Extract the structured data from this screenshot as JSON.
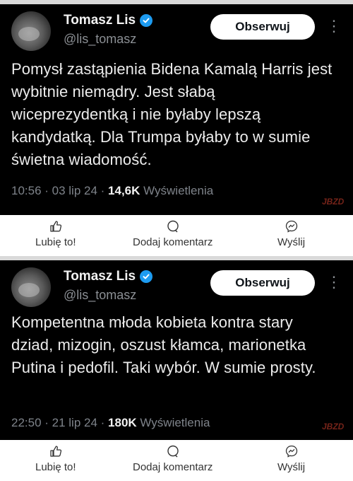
{
  "posts": [
    {
      "author_name": "Tomasz Lis",
      "handle": "@lis_tomasz",
      "follow_label": "Obserwuj",
      "text": "Pomysł zastąpienia Bidena Kamalą Harris jest wybitnie niemądry. Jest słabą wiceprezydentką i nie byłaby lepszą kandydatką. Dla Trumpa  byłaby to w sumie świetna wiadomość.",
      "time_date": "10:56 · 03 lip 24 · ",
      "views_count": "14,6K",
      "views_label": " Wyświetlenia",
      "watermark": "JBZD"
    },
    {
      "author_name": "Tomasz Lis",
      "handle": "@lis_tomasz",
      "follow_label": "Obserwuj",
      "text": "Kompetentna młoda kobieta kontra stary dziad, mizogin, oszust  kłamca, marionetka Putina i pedofil. Taki wybór. W sumie prosty.",
      "time_date": "22:50 · 21 lip 24 · ",
      "views_count": "180K",
      "views_label": " Wyświetlenia",
      "watermark": "JBZD"
    }
  ],
  "actions": {
    "like_label": "Lubię to!",
    "comment_label": "Dodaj komentarz",
    "share_label": "Wyślij"
  },
  "colors": {
    "verified": "#1d9bf0",
    "card_bg": "#000000",
    "follow_bg": "#ffffff"
  }
}
